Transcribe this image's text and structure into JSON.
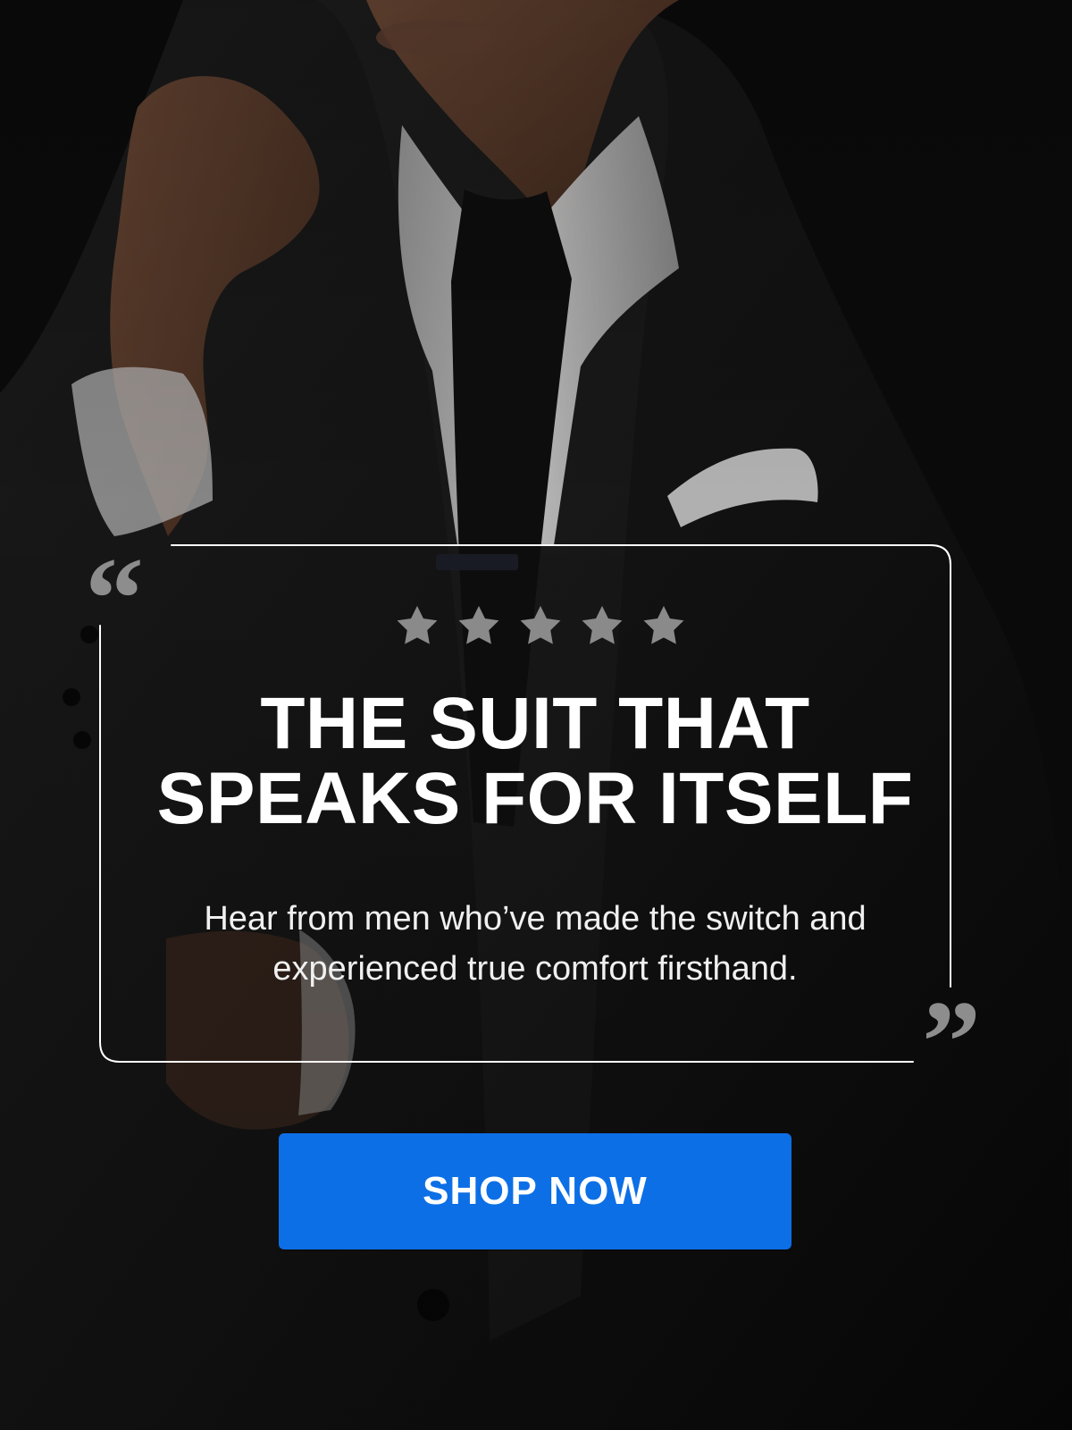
{
  "theme": {
    "background_color": "#111111",
    "frame_color": "#ffffff",
    "quote_color": "#8d8d8d",
    "star_color": "#8a8a8a",
    "cta_color": "#0c6fe6",
    "headline_color": "#ffffff",
    "subtext_color": "#f0f0f0"
  },
  "icons": {
    "open_quote": "open-quote-icon",
    "close_quote": "close-quote-icon",
    "rating_star": "star-icon"
  },
  "review": {
    "rating": 5,
    "rating_max": 5,
    "headline": {
      "line1": "THE SUIT THAT",
      "line2": "SPEAKS FOR ITSELF"
    },
    "subtext": {
      "line1": "Hear from men who’ve made the switch and",
      "line2": "experienced true comfort firsthand."
    }
  },
  "cta": {
    "label": "SHOP NOW"
  }
}
